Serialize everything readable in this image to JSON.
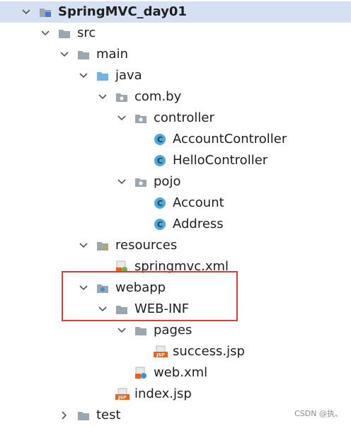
{
  "tree": {
    "nodes": [
      {
        "label": "SpringMVC_day01",
        "icon": "project-folder-icon",
        "expanded": true
      },
      {
        "label": "src",
        "icon": "folder-icon",
        "expanded": true
      },
      {
        "label": "main",
        "icon": "folder-icon",
        "expanded": true
      },
      {
        "label": "java",
        "icon": "source-root-folder-icon",
        "expanded": true
      },
      {
        "label": "com.by",
        "icon": "package-icon",
        "expanded": true
      },
      {
        "label": "controller",
        "icon": "package-icon",
        "expanded": true
      },
      {
        "label": "AccountController",
        "icon": "java-class-icon"
      },
      {
        "label": "HelloController",
        "icon": "java-class-icon"
      },
      {
        "label": "pojo",
        "icon": "package-icon",
        "expanded": true
      },
      {
        "label": "Account",
        "icon": "java-class-icon"
      },
      {
        "label": "Address",
        "icon": "java-class-icon"
      },
      {
        "label": "resources",
        "icon": "resources-folder-icon",
        "expanded": true
      },
      {
        "label": "springmvc.xml",
        "icon": "spring-xml-icon"
      },
      {
        "label": "webapp",
        "icon": "web-folder-icon",
        "expanded": true
      },
      {
        "label": "WEB-INF",
        "icon": "folder-icon",
        "expanded": true
      },
      {
        "label": "pages",
        "icon": "folder-icon",
        "expanded": true
      },
      {
        "label": "success.jsp",
        "icon": "jsp-file-icon"
      },
      {
        "label": "web.xml",
        "icon": "web-xml-icon"
      },
      {
        "label": "index.jsp",
        "icon": "jsp-file-icon"
      },
      {
        "label": "test",
        "icon": "folder-icon",
        "expanded": false
      }
    ]
  },
  "icon_text": {
    "class_letter": "C",
    "jsp_badge": "JSP"
  },
  "watermark": "CSDN @执、",
  "colors": {
    "selected_row": "#d5e1f2",
    "folder": "#9aa7b1",
    "source_folder": "#6eb4e6",
    "class_icon": "#4fa8d8",
    "jsp_badge": "#e5631f",
    "highlight_box": "#e03b3b"
  }
}
